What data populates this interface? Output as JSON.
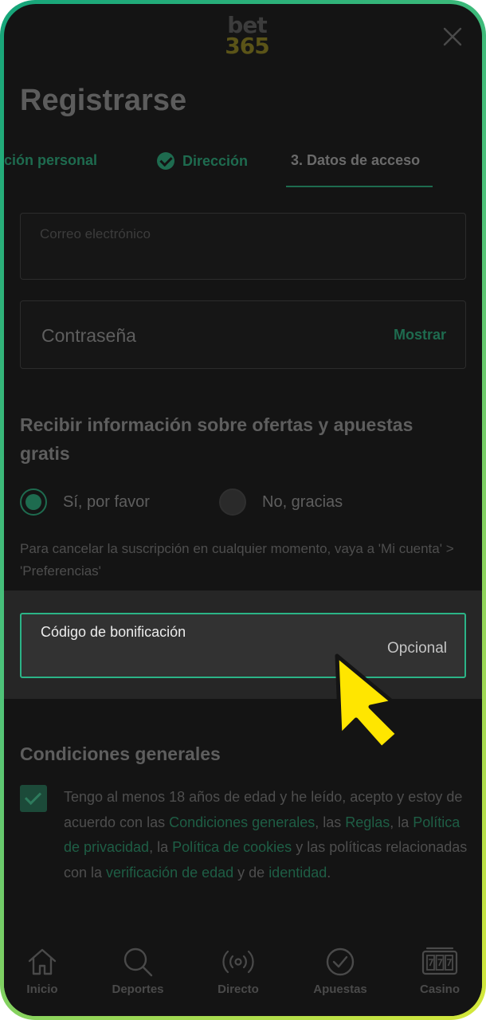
{
  "header": {
    "logo_line1": "bet",
    "logo_line2": "365",
    "title": "Registrarse"
  },
  "steps": {
    "step1_label": "ación personal",
    "step2_label": "Dirección",
    "step3_label": "3.  Datos de acceso"
  },
  "form": {
    "email_placeholder": "Correo electrónico",
    "password_placeholder": "Contraseña",
    "show_password": "Mostrar",
    "offers_title": "Recibir información sobre ofertas y apuestas gratis",
    "option_yes": "Sí, por favor",
    "option_no": "No, gracias",
    "unsubscribe_note": "Para cancelar la suscripción en cualquier momento, vaya a 'Mi cuenta' > 'Preferencias'",
    "bonus_label": "Código de bonificación",
    "bonus_optional": "Opcional"
  },
  "conditions": {
    "title": "Condiciones generales",
    "t1": "Tengo al menos 18 años de edad y he leído, acepto y estoy de acuerdo con las ",
    "l1": "Condiciones generales",
    "t2": ", las ",
    "l2": "Reglas",
    "t3": ", la ",
    "l3": "Política de privacidad",
    "t4": ", la ",
    "l4": "Política de cookies",
    "t5": " y las políticas relacionadas con la ",
    "l5": "verificación de edad",
    "t6": " y de ",
    "l6": "identidad",
    "t7": "."
  },
  "nav": {
    "home": "Inicio",
    "sports": "Deportes",
    "live": "Directo",
    "bets": "Apuestas",
    "casino": "Casino"
  },
  "colors": {
    "accent": "#2bb487",
    "cursor": "#ffe600",
    "background": "#141414"
  }
}
